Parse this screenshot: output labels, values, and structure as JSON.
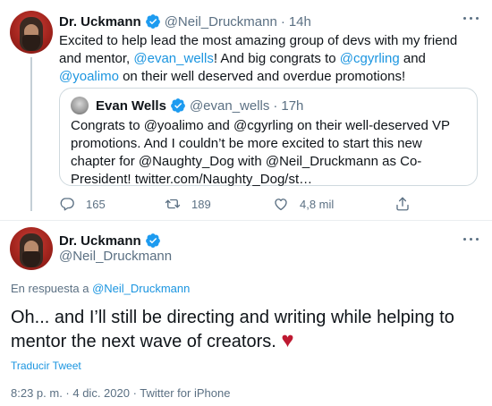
{
  "parent_tweet": {
    "author_name": "Dr. Uckmann",
    "author_handle": "@Neil_Druckmann",
    "time_ago": "14h",
    "text_parts": {
      "t1": "Excited to help lead the most amazing group of devs with my friend and mentor, ",
      "m1": "@evan_wells",
      "t2": "! And big congrats to ",
      "m2": "@cgyrling",
      "t3": " and ",
      "m3": "@yoalimo",
      "t4": " on their well deserved and overdue promotions!"
    },
    "quoted": {
      "author_name": "Evan Wells",
      "author_handle": "@evan_wells",
      "time_ago": "17h",
      "text": "Congrats to @yoalimo and @cgyrling on their well-deserved VP promotions. And I couldn’t be more excited to start this new chapter for @Naughty_Dog with @Neil_Druckmann as Co-President! twitter.com/Naughty_Dog/st…"
    },
    "actions": {
      "replies": "165",
      "retweets": "189",
      "likes": "4,8 mil"
    }
  },
  "main_tweet": {
    "author_name": "Dr. Uckmann",
    "author_handle": "@Neil_Druckmann",
    "reply_prefix": "En respuesta a",
    "reply_to": "@Neil_Druckmann",
    "text": "Oh... and I’ll still be directing and writing while helping to mentor the next wave of creators.",
    "emoji": "♥",
    "translate_label": "Traducir Tweet",
    "timestamp": "8:23 p. m. · 4 dic. 2020 · Twitter for iPhone"
  },
  "colors": {
    "link": "#1b95e0",
    "muted": "#5b7083",
    "heart": "#be1931"
  }
}
